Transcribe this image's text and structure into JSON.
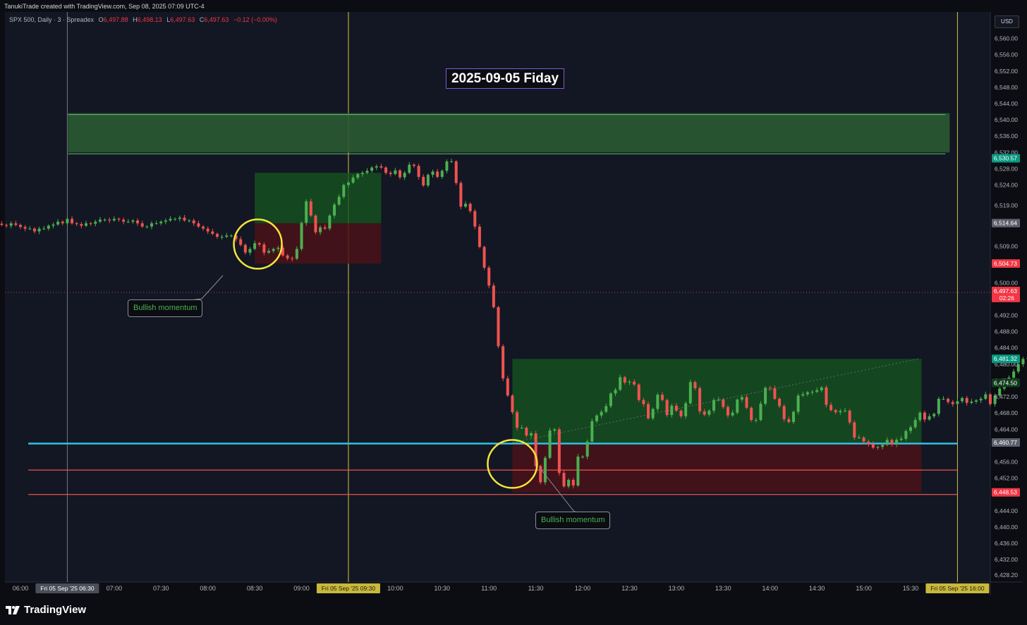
{
  "header": {
    "credit": "TanukiTrade created with TradingView.com, Sep 08, 2025 07:09 UTC-4",
    "symbol": "SPX 500, Daily · 3 · Spreadex",
    "ohlc": [
      {
        "label": "O",
        "value": "6,497.88"
      },
      {
        "label": "H",
        "value": "6,498.13"
      },
      {
        "label": "L",
        "value": "6,497.63"
      },
      {
        "label": "C",
        "value": "6,497.63"
      }
    ],
    "change": "−0.12 (−0.00%)",
    "currency": "USD"
  },
  "footer": {
    "brand": "TradingView"
  },
  "colors": {
    "up": "#4caf50",
    "down": "#ef5350",
    "background": "#0b0d12",
    "zone_green": "#15521f",
    "zone_red": "#4a1219",
    "cyan_line": "#2fc1e6",
    "vline": "#d4c445",
    "title_border": "#7b5cd6"
  },
  "chart_data": {
    "type": "candlestick",
    "title": "2025-09-05 Fiday",
    "ylim": [
      6426.5,
      6566.5
    ],
    "y_ticks": [
      "6,564.00",
      "6,560.00",
      "6,556.00",
      "6,552.00",
      "6,548.00",
      "6,544.00",
      "6,540.00",
      "6,536.00",
      "6,532.00",
      "6,528.00",
      "6,524.00",
      "6,519.00",
      "6,509.00",
      "6,500.00",
      "6,492.00",
      "6,488.00",
      "6,484.00",
      "6,480.00",
      "6,476.00",
      "6,472.00",
      "6,468.00",
      "6,464.00",
      "6,456.00",
      "6,452.00",
      "6,444.00",
      "6,440.00",
      "6,436.00",
      "6,432.00",
      "6,428.20"
    ],
    "x_ticks": [
      "06:00",
      "07:00",
      "07:30",
      "08:00",
      "08:30",
      "09:00",
      "10:00",
      "10:30",
      "11:00",
      "11:30",
      "12:00",
      "12:30",
      "13:00",
      "13:30",
      "14:00",
      "14:30",
      "15:00",
      "15:30"
    ],
    "x_tick_times": [
      360,
      420,
      450,
      480,
      510,
      540,
      600,
      630,
      660,
      690,
      720,
      750,
      780,
      810,
      840,
      870,
      900,
      930
    ],
    "x_highlights": [
      {
        "label": "Fri 05 Sep '25   06:30",
        "time": 390,
        "style": "gray"
      },
      {
        "label": "Fri 05 Sep '25   09:30",
        "time": 570,
        "style": "yellow"
      },
      {
        "label": "Fri 05 Sep '25   16:00",
        "time": 960,
        "style": "yellow"
      }
    ],
    "price_labels": [
      {
        "text": "6,530.57",
        "value": 6530.57,
        "color": "#089981"
      },
      {
        "text": "6,514.64",
        "value": 6514.64,
        "color": "#5d606b"
      },
      {
        "text": "6,504.73",
        "value": 6504.73,
        "color": "#f23645"
      },
      {
        "text": "6,497.63",
        "value": 6498.0,
        "color": "#f23645",
        "sub": "02:26"
      },
      {
        "text": "6,481.32",
        "value": 6481.32,
        "color": "#089981"
      },
      {
        "text": "6,474.50",
        "value": 6475.4,
        "color": "#0f3d1a"
      },
      {
        "text": "6,460.77",
        "value": 6460.77,
        "color": "#5d606b"
      },
      {
        "text": "6,448.53",
        "value": 6448.53,
        "color": "#f23645"
      }
    ],
    "annotations": [
      "Bullish momentum",
      "Bullish momentum"
    ],
    "levels": {
      "supply_zone": [
        6532.0,
        6541.3
      ],
      "cyan": 6460.5,
      "red_lines": [
        6454.0,
        6448.0
      ],
      "current": 6497.63
    },
    "candles_closes": [
      6514.7,
      6514.5,
      6514.2,
      6514.0,
      6514.6,
      6514.2,
      6513.7,
      6513.3,
      6513.3,
      6512.6,
      6513.3,
      6513.3,
      6514.0,
      6514.3,
      6515.0,
      6514.6,
      6515.7,
      6514.6,
      6514.4,
      6514.0,
      6514.6,
      6514.5,
      6515.0,
      6515.5,
      6515.5,
      6515.3,
      6515.7,
      6515.5,
      6515.0,
      6515.0,
      6515.3,
      6514.6,
      6513.8,
      6513.8,
      6514.6,
      6514.6,
      6515.0,
      6515.3,
      6515.7,
      6515.7,
      6516.0,
      6515.3,
      6515.3,
      6514.6,
      6513.8,
      6513.3,
      6512.6,
      6512.0,
      6511.3,
      6511.3,
      6511.6,
      6511.6,
      6510.7,
      6509.3,
      6507.4,
      6508.3,
      6509.7,
      6509.4,
      6507.4,
      6507.8,
      6508.3,
      6508.6,
      6506.7,
      6506.0,
      6505.9,
      6508.3,
      6514.7,
      6520.0,
      6516.5,
      6512.4,
      6513.6,
      6513.3,
      6516.5,
      6519.2,
      6521.1,
      6524.0,
      6524.6,
      6525.8,
      6526.7,
      6527.0,
      6527.5,
      6528.3,
      6528.6,
      6528.3,
      6527.0,
      6526.7,
      6527.6,
      6525.9,
      6527.0,
      6529.0,
      6528.7,
      6526.0,
      6523.9,
      6526.5,
      6527.3,
      6526.0,
      6527.5,
      6529.8,
      6529.8,
      6524.5,
      6518.7,
      6519.4,
      6517.6,
      6513.8,
      6508.8,
      6503.7,
      6499.3,
      6494.0,
      6484.4,
      6476.5,
      6472.3,
      6468.2,
      6464.4,
      6464.4,
      6462.5,
      6463.0,
      6455.0,
      6451.0,
      6457.0,
      6463.7,
      6464.0,
      6453.3,
      6450.0,
      6451.6,
      6450.2,
      6457.3,
      6457.3,
      6461.0,
      6466.0,
      6467.4,
      6468.3,
      6469.7,
      6472.8,
      6473.7,
      6476.8,
      6475.5,
      6475.7,
      6475.0,
      6471.2,
      6470.2,
      6466.7,
      6469.0,
      6472.5,
      6471.2,
      6467.5,
      6469.8,
      6468.6,
      6467.2,
      6470.4,
      6475.6,
      6474.1,
      6468.4,
      6467.6,
      6468.6,
      6471.2,
      6471.3,
      6469.5,
      6467.4,
      6468.1,
      6471.3,
      6471.9,
      6469.3,
      6466.3,
      6466.3,
      6470.3,
      6474.2,
      6474.1,
      6471.5,
      6469.7,
      6466.5,
      6465.8,
      6468.3,
      6472.3,
      6472.6,
      6473.1,
      6473.2,
      6473.6,
      6474.3,
      6470.0,
      6468.7,
      6468.2,
      6468.5,
      6468.6,
      6465.7,
      6462.0,
      6462.0,
      6461.0,
      6460.4,
      6459.5,
      6459.7,
      6460.2,
      6461.4,
      6460.3,
      6461.4,
      6461.7,
      6463.6,
      6464.5,
      6466.3,
      6468.1,
      6466.4,
      6467.2,
      6467.8,
      6471.5,
      6471.5,
      6470.7,
      6470.2,
      6470.9,
      6471.7,
      6470.5,
      6470.8,
      6471.1,
      6471.5,
      6472.6,
      6470.2,
      6472.3,
      6474.0,
      6475.9,
      6476.7,
      6478.2,
      6480.0,
      6481.3,
      6481.5,
      6481.8,
      6482.0,
      6479.5,
      6474.1,
      6476.0,
      6477.3,
      6475.4,
      6476.0,
      6474.8,
      6474.6,
      6473.3,
      6472.8,
      6476.5,
      6481.0,
      6480.0,
      6479.3,
      6478.8,
      6477.2,
      6474.5,
      6474.8
    ]
  }
}
